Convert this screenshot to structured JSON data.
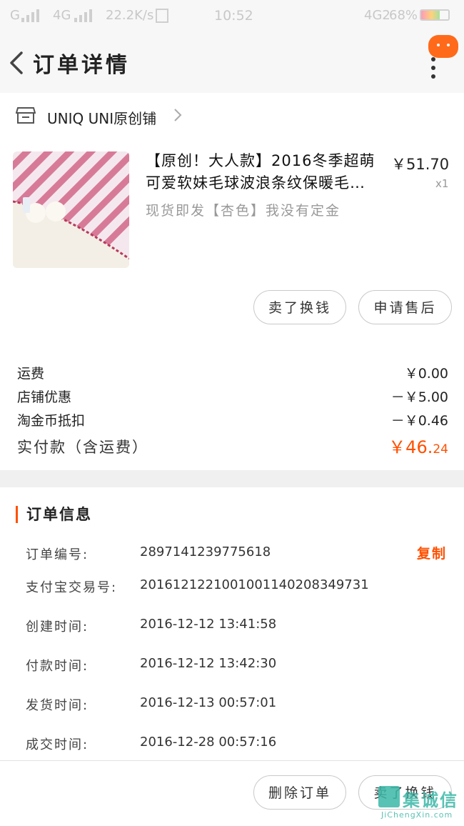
{
  "status_bar": {
    "signal_left": "G",
    "network": "4G",
    "speed": "22.2K/s",
    "time": "10:52",
    "network_right": "4G2",
    "battery": "68%"
  },
  "header": {
    "title": "订单详情"
  },
  "shop": {
    "name": "UNIQ UNI原创铺"
  },
  "product": {
    "title": "【原创！大人款】2016冬季超萌可爱软妹毛球波浪条纹保暖毛…",
    "price": "￥51.70",
    "quantity": "x1",
    "variant": "现货即发【杏色】我没有定金"
  },
  "product_actions": {
    "sell_label": "卖了换钱",
    "after_sale_label": "申请售后"
  },
  "fees": [
    {
      "label": "运费",
      "value": "￥0.00"
    },
    {
      "label": "店铺优惠",
      "value": "－￥5.00"
    },
    {
      "label": "淘金币抵扣",
      "value": "－￥0.46"
    }
  ],
  "total": {
    "label": "实付款（含运费）",
    "main": "￥46.",
    "cents": "24"
  },
  "order_info": {
    "title": "订单信息",
    "copy_label": "复制",
    "rows": [
      {
        "label": "订单编号:",
        "value": "2897141239775618"
      },
      {
        "label": "支付宝交易号:",
        "value": "2016121221001001140208349731"
      },
      {
        "label": "创建时间:",
        "value": "2016-12-12 13:41:58"
      },
      {
        "label": "付款时间:",
        "value": "2016-12-12 13:42:30"
      },
      {
        "label": "发货时间:",
        "value": "2016-12-13 00:57:01"
      },
      {
        "label": "成交时间:",
        "value": "2016-12-28 00:57:16"
      }
    ]
  },
  "footer": {
    "delete_label": "删除订单",
    "sell_label": "卖了换钱"
  },
  "watermark": {
    "text": "集诚信",
    "url": "JiChengXin.com"
  },
  "colors": {
    "accent": "#ff5000",
    "message_badge": "#ff6a1a"
  }
}
